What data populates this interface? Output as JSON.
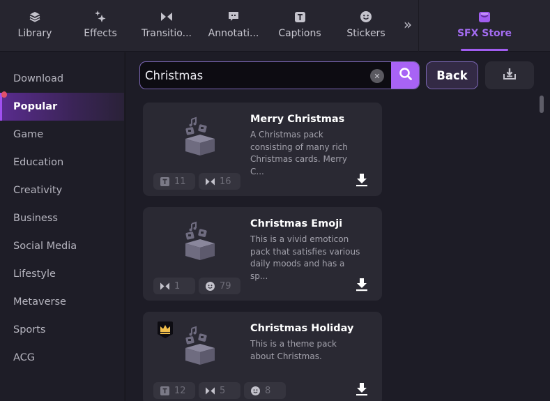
{
  "tabs": [
    {
      "label": "Library",
      "icon": "layers-icon"
    },
    {
      "label": "Effects",
      "icon": "sparkle-icon"
    },
    {
      "label": "Transitio...",
      "icon": "transition-icon"
    },
    {
      "label": "Annotati...",
      "icon": "annotation-icon"
    },
    {
      "label": "Captions",
      "icon": "captions-icon"
    },
    {
      "label": "Stickers",
      "icon": "sticker-icon"
    }
  ],
  "more_tabs_icon": "double-chevron-right-icon",
  "active_tab": {
    "label": "SFX Store",
    "icon": "store-icon",
    "color": "#a46cf2"
  },
  "sidebar": {
    "items": [
      {
        "label": "Download",
        "active": false
      },
      {
        "label": "Popular",
        "active": true
      },
      {
        "label": "Game",
        "active": false
      },
      {
        "label": "Education",
        "active": false
      },
      {
        "label": "Creativity",
        "active": false
      },
      {
        "label": "Business",
        "active": false
      },
      {
        "label": "Social Media",
        "active": false
      },
      {
        "label": "Lifestyle",
        "active": false
      },
      {
        "label": "Metaverse",
        "active": false
      },
      {
        "label": "Sports",
        "active": false
      },
      {
        "label": "ACG",
        "active": false
      }
    ]
  },
  "search": {
    "value": "Christmas",
    "placeholder": ""
  },
  "toolbar": {
    "back_label": "Back"
  },
  "cards": [
    {
      "title": "Merry Christmas",
      "description": "A Christmas pack consisting of many rich Christmas cards. Merry C...",
      "premium": false,
      "stats": [
        {
          "type": "captions",
          "count": "11"
        },
        {
          "type": "transitions",
          "count": "16"
        }
      ]
    },
    {
      "title": "Christmas Emoji",
      "description": "This is a vivid emoticon pack that satisfies various daily moods and has a sp...",
      "premium": false,
      "stats": [
        {
          "type": "transitions",
          "count": "1"
        },
        {
          "type": "stickers",
          "count": "79"
        }
      ]
    },
    {
      "title": "Christmas Holiday",
      "description": "This is a theme pack about Christmas.",
      "premium": true,
      "stats": [
        {
          "type": "captions",
          "count": "12"
        },
        {
          "type": "transitions",
          "count": "5"
        },
        {
          "type": "stickers",
          "count": "8"
        }
      ]
    }
  ],
  "colors": {
    "accent": "#a863f5",
    "background": "#1d1c26",
    "card": "#2a2933"
  }
}
